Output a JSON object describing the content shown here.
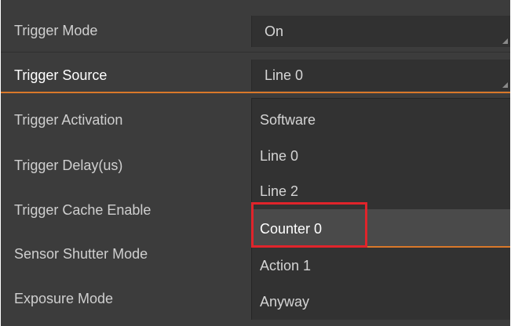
{
  "properties": [
    {
      "label": "Trigger Mode"
    },
    {
      "label": "Trigger Source"
    },
    {
      "label": "Trigger Activation"
    },
    {
      "label": "Trigger Delay(us)"
    },
    {
      "label": "Trigger Cache Enable"
    },
    {
      "label": "Sensor Shutter Mode"
    },
    {
      "label": "Exposure Mode"
    }
  ],
  "values": {
    "trigger_mode": "On",
    "trigger_source": "Line 0"
  },
  "dropdown": {
    "options": [
      {
        "label": "Software"
      },
      {
        "label": "Line 0"
      },
      {
        "label": "Line 2"
      },
      {
        "label": "Counter 0"
      },
      {
        "label": "Action 1"
      },
      {
        "label": "Anyway"
      }
    ],
    "highlighted_option": "Counter 0"
  },
  "colors": {
    "background": "#3c3c3c",
    "value_background": "#313131",
    "accent_orange": "#d9782a",
    "annotation_red": "#e0242b",
    "text": "#d6d6d6"
  }
}
